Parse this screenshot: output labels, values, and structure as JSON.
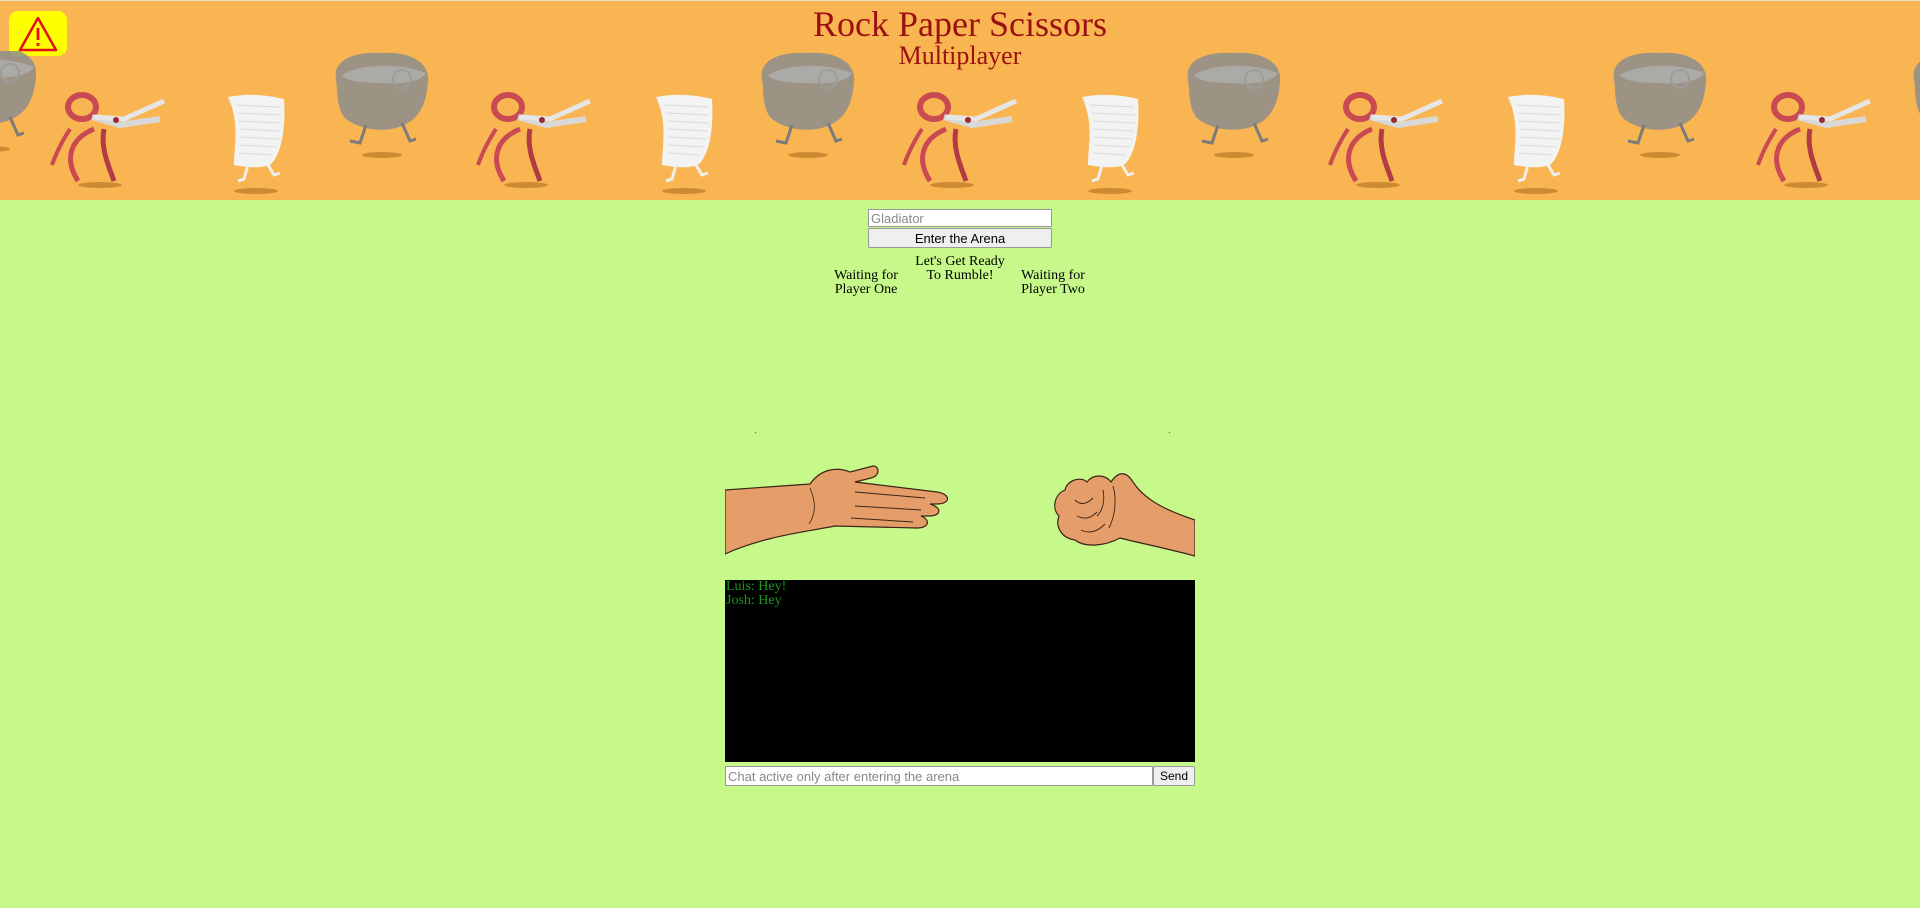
{
  "header": {
    "title": "Rock Paper Scissors",
    "subtitle": "Multiplayer",
    "warning_icon": "warning-triangle-icon",
    "bg_color": "#f9b552",
    "title_color": "#9b1010"
  },
  "parade": {
    "sequence": [
      "rock",
      "scissors",
      "paper",
      "rock",
      "scissors",
      "paper",
      "rock",
      "scissors",
      "paper",
      "rock",
      "scissors",
      "paper",
      "rock",
      "scissors",
      "paper",
      "rock"
    ]
  },
  "login": {
    "name_placeholder": "Gladiator",
    "enter_label": "Enter the Arena"
  },
  "status": {
    "player_one": "Waiting for Player One",
    "center": "Let's Get Ready To Rumble!",
    "player_two": "Waiting for Player Two"
  },
  "arena": {
    "left_hand": "paper-hand-icon",
    "right_hand": "rock-fist-icon"
  },
  "chat": {
    "messages": [
      {
        "text": "Luis: Hey!"
      },
      {
        "text": "Josh: Hey"
      }
    ],
    "input_placeholder": "Chat active only after entering the arena",
    "send_label": "Send",
    "text_color": "#1a9a1a"
  },
  "colors": {
    "background": "#c6f98a"
  }
}
